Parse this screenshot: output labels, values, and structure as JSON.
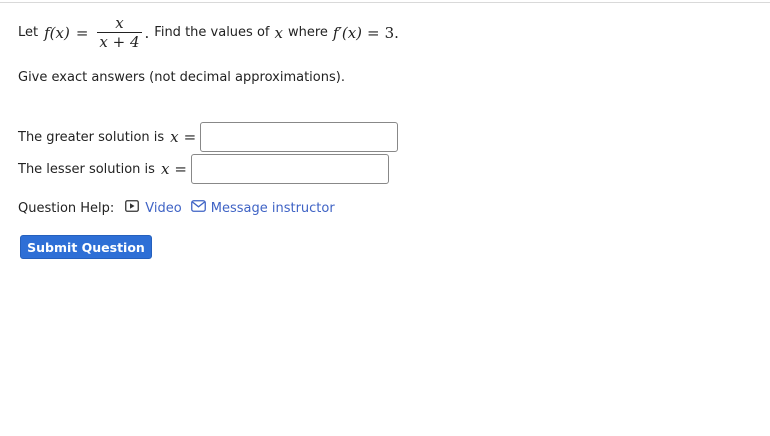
{
  "question": {
    "let_text": "Let",
    "fx": "f(x)",
    "equals": "=",
    "numerator": "x",
    "denominator": "x + 4",
    "period": ".",
    "find_text": "Find the values of",
    "x_var": "x",
    "where_text": "where",
    "fprime": "f′(x)",
    "equals2": "=",
    "value": "3",
    "period2": ".",
    "instruction": "Give exact answers (not decimal approximations)."
  },
  "answers": {
    "greater_label": "The greater solution is",
    "greater_var": "x",
    "greater_eq": "=",
    "greater_value": "",
    "lesser_label": "The lesser solution is",
    "lesser_var": "x",
    "lesser_eq": "=",
    "lesser_value": ""
  },
  "help": {
    "label": "Question Help:",
    "video_label": "Video",
    "video_icon": "video-icon",
    "message_label": "Message instructor",
    "message_icon": "envelope-icon"
  },
  "submit_label": "Submit Question",
  "colors": {
    "accent": "#2e6fd6",
    "link": "#3f63c5"
  }
}
